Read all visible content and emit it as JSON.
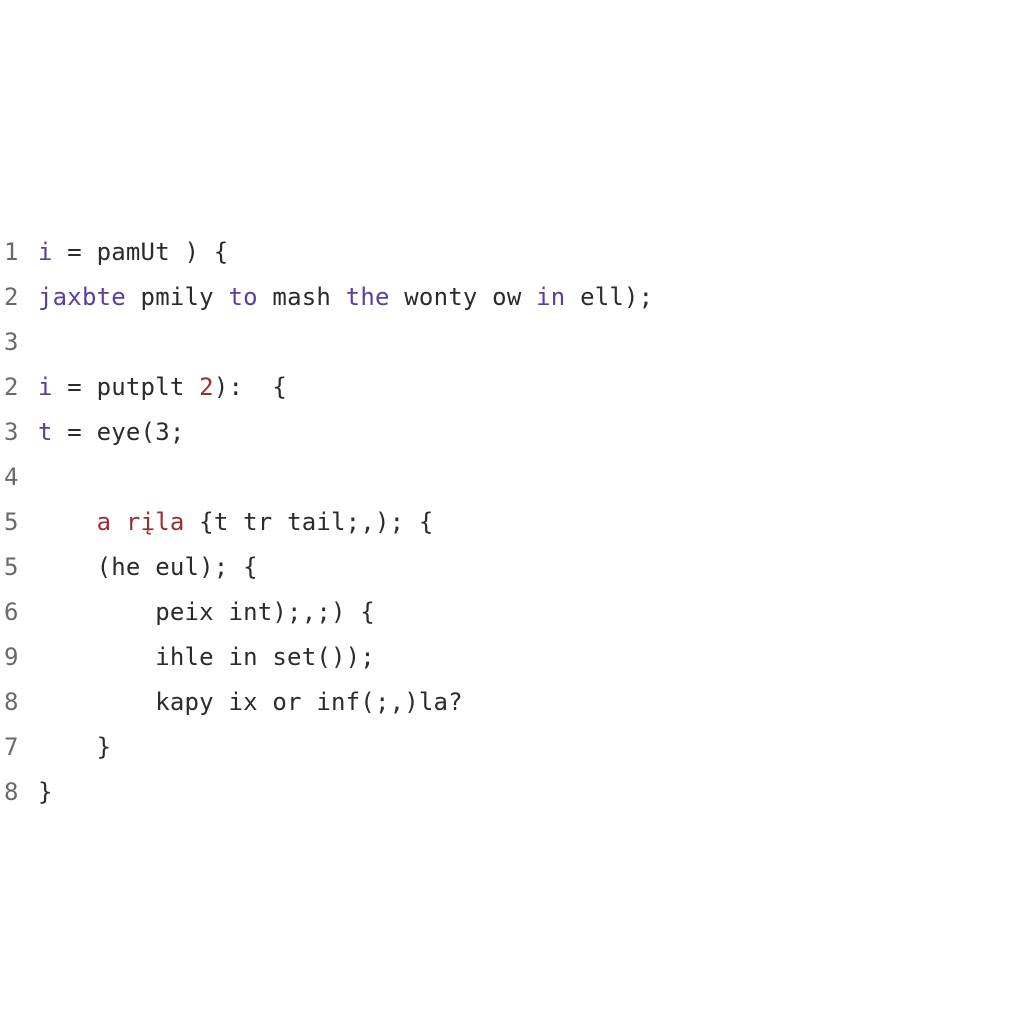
{
  "editor": {
    "lines": [
      {
        "n": "1",
        "indent": "",
        "tokens": [
          {
            "cls": "tok-var",
            "t": "i"
          },
          {
            "cls": "tok-plain",
            "t": " = pamUt ) {"
          }
        ]
      },
      {
        "n": "2",
        "indent": "",
        "tokens": [
          {
            "cls": "tok-var",
            "t": "jaxbte"
          },
          {
            "cls": "tok-plain",
            "t": " pmily "
          },
          {
            "cls": "tok-var",
            "t": "to"
          },
          {
            "cls": "tok-plain",
            "t": " mash "
          },
          {
            "cls": "tok-var",
            "t": "the"
          },
          {
            "cls": "tok-plain",
            "t": " wonty ow "
          },
          {
            "cls": "tok-var",
            "t": "in"
          },
          {
            "cls": "tok-plain",
            "t": " ell);"
          }
        ]
      },
      {
        "n": "3",
        "indent": "",
        "tokens": []
      },
      {
        "n": "2",
        "indent": "",
        "tokens": [
          {
            "cls": "tok-var",
            "t": "i"
          },
          {
            "cls": "tok-plain",
            "t": " = putplt "
          },
          {
            "cls": "tok-num",
            "t": "2"
          },
          {
            "cls": "tok-plain",
            "t": "):  {"
          }
        ]
      },
      {
        "n": "3",
        "indent": "",
        "tokens": [
          {
            "cls": "tok-var",
            "t": "t"
          },
          {
            "cls": "tok-plain",
            "t": " = eye("
          },
          {
            "cls": "tok-plain",
            "t": "3"
          },
          {
            "cls": "tok-plain",
            "t": ";"
          }
        ]
      },
      {
        "n": "4",
        "indent": "",
        "tokens": []
      },
      {
        "n": "5",
        "indent": "    ",
        "tokens": [
          {
            "cls": "tok-kw",
            "t": "a"
          },
          {
            "cls": "tok-plain",
            "t": " "
          },
          {
            "cls": "tok-kw",
            "t": "rįla"
          },
          {
            "cls": "tok-plain",
            "t": " {t tr tail;,); {"
          }
        ]
      },
      {
        "n": "5",
        "indent": "    ",
        "tokens": [
          {
            "cls": "tok-plain",
            "t": "(he eul); {"
          }
        ]
      },
      {
        "n": "6",
        "indent": "        ",
        "tokens": [
          {
            "cls": "tok-plain",
            "t": "peix int);,;) {"
          }
        ]
      },
      {
        "n": "9",
        "indent": "        ",
        "tokens": [
          {
            "cls": "tok-plain",
            "t": "ihle in set());"
          }
        ]
      },
      {
        "n": "8",
        "indent": "        ",
        "tokens": [
          {
            "cls": "tok-plain",
            "t": "kapy ix or inf(;,)la?"
          }
        ]
      },
      {
        "n": "7",
        "indent": "    ",
        "tokens": [
          {
            "cls": "tok-plain",
            "t": "}"
          }
        ]
      },
      {
        "n": "8",
        "indent": "",
        "tokens": [
          {
            "cls": "tok-plain",
            "t": "}"
          }
        ]
      }
    ]
  }
}
